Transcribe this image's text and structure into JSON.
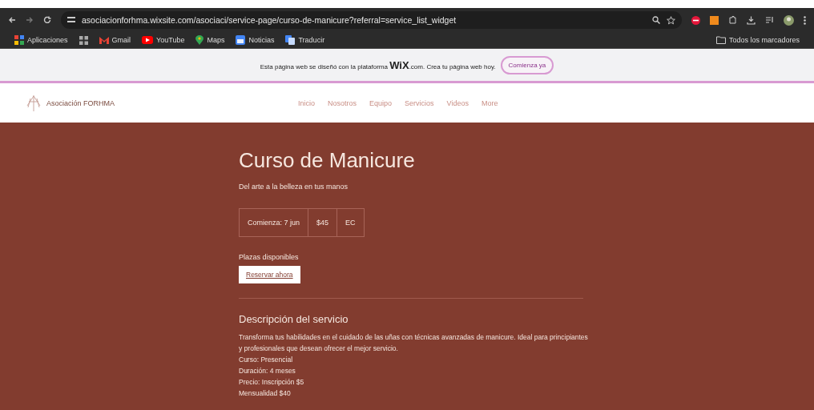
{
  "browser": {
    "url": "asociacionforhma.wixsite.com/asociaci/service-page/curso-de-manicure?referral=service_list_widget",
    "bookmarks": [
      {
        "label": "Aplicaciones",
        "kind": "apps"
      },
      {
        "label": "Gmail",
        "kind": "gmail"
      },
      {
        "label": "YouTube",
        "kind": "youtube"
      },
      {
        "label": "Maps",
        "kind": "maps"
      },
      {
        "label": "Noticias",
        "kind": "news"
      },
      {
        "label": "Traducir",
        "kind": "translate"
      }
    ],
    "all_bookmarks": "Todos los marcadores"
  },
  "wix_banner": {
    "text_before": "Esta página web se diseñó con la plataforma",
    "brand": "WiX",
    "text_after": ".com. Crea tu página web hoy.",
    "button": "Comienza ya"
  },
  "site_header": {
    "logo": "Asociación FORHMA",
    "nav": [
      "Inicio",
      "Nosotros",
      "Equipo",
      "Servicios",
      "Videos",
      "More"
    ]
  },
  "service": {
    "title": "Curso de Manicure",
    "tagline": "Del arte a la belleza en tus manos",
    "details": [
      "Comienza: 7 jun",
      "$45",
      "EC"
    ],
    "availability": "Plazas disponibles",
    "book_button": "Reservar ahora",
    "description_title": "Descripción del servicio",
    "description": [
      "Transforma tus habilidades en el cuidado de las uñas con técnicas avanzadas de manicure. Ideal para principiantes y profesionales que desean ofrecer el mejor servicio.",
      "Curso: Presencial",
      "Duración: 4 meses",
      "Precio: Inscripción $5",
      "Mensualidad $40"
    ]
  }
}
